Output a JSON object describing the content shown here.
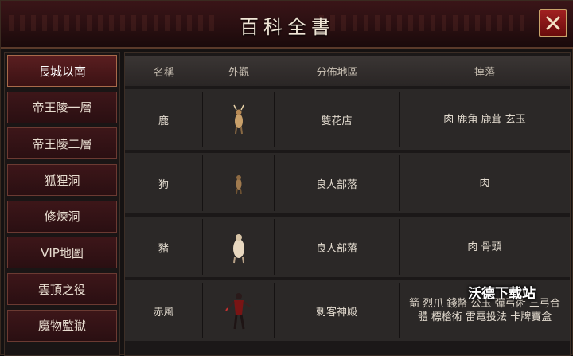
{
  "window": {
    "title": "百科全書",
    "close_icon": "close-icon"
  },
  "sidebar": {
    "items": [
      {
        "label": "長城以南",
        "active": true
      },
      {
        "label": "帝王陵一層"
      },
      {
        "label": "帝王陵二層"
      },
      {
        "label": "狐狸洞"
      },
      {
        "label": "修煉洞"
      },
      {
        "label": "VIP地圖"
      },
      {
        "label": "雲頂之役"
      },
      {
        "label": "魔物監獄"
      }
    ]
  },
  "table": {
    "headers": [
      "名稱",
      "外觀",
      "分佈地區",
      "掉落"
    ],
    "rows": [
      {
        "name": "鹿",
        "appearance": "deer-sprite",
        "region": "雙花店",
        "drops": "肉 鹿角 鹿茸 玄玉"
      },
      {
        "name": "狗",
        "appearance": "dog-sprite",
        "region": "良人部落",
        "drops": "肉"
      },
      {
        "name": "豬",
        "appearance": "pig-sprite",
        "region": "良人部落",
        "drops": "肉 骨頭"
      },
      {
        "name": "赤風",
        "appearance": "red-wind-sprite",
        "region": "刺客神殿",
        "drops": "箭 烈爪 錢幣 公玉 彈弓術 三弓合體 標槍術 雷電投法 卡牌寶盒"
      }
    ]
  },
  "watermark": "沃德下载站",
  "colors": {
    "title_bar": "#2a0f11",
    "close_button": "#a02020",
    "border_gold": "#c9a46a",
    "row_bg": "#2b2827"
  }
}
